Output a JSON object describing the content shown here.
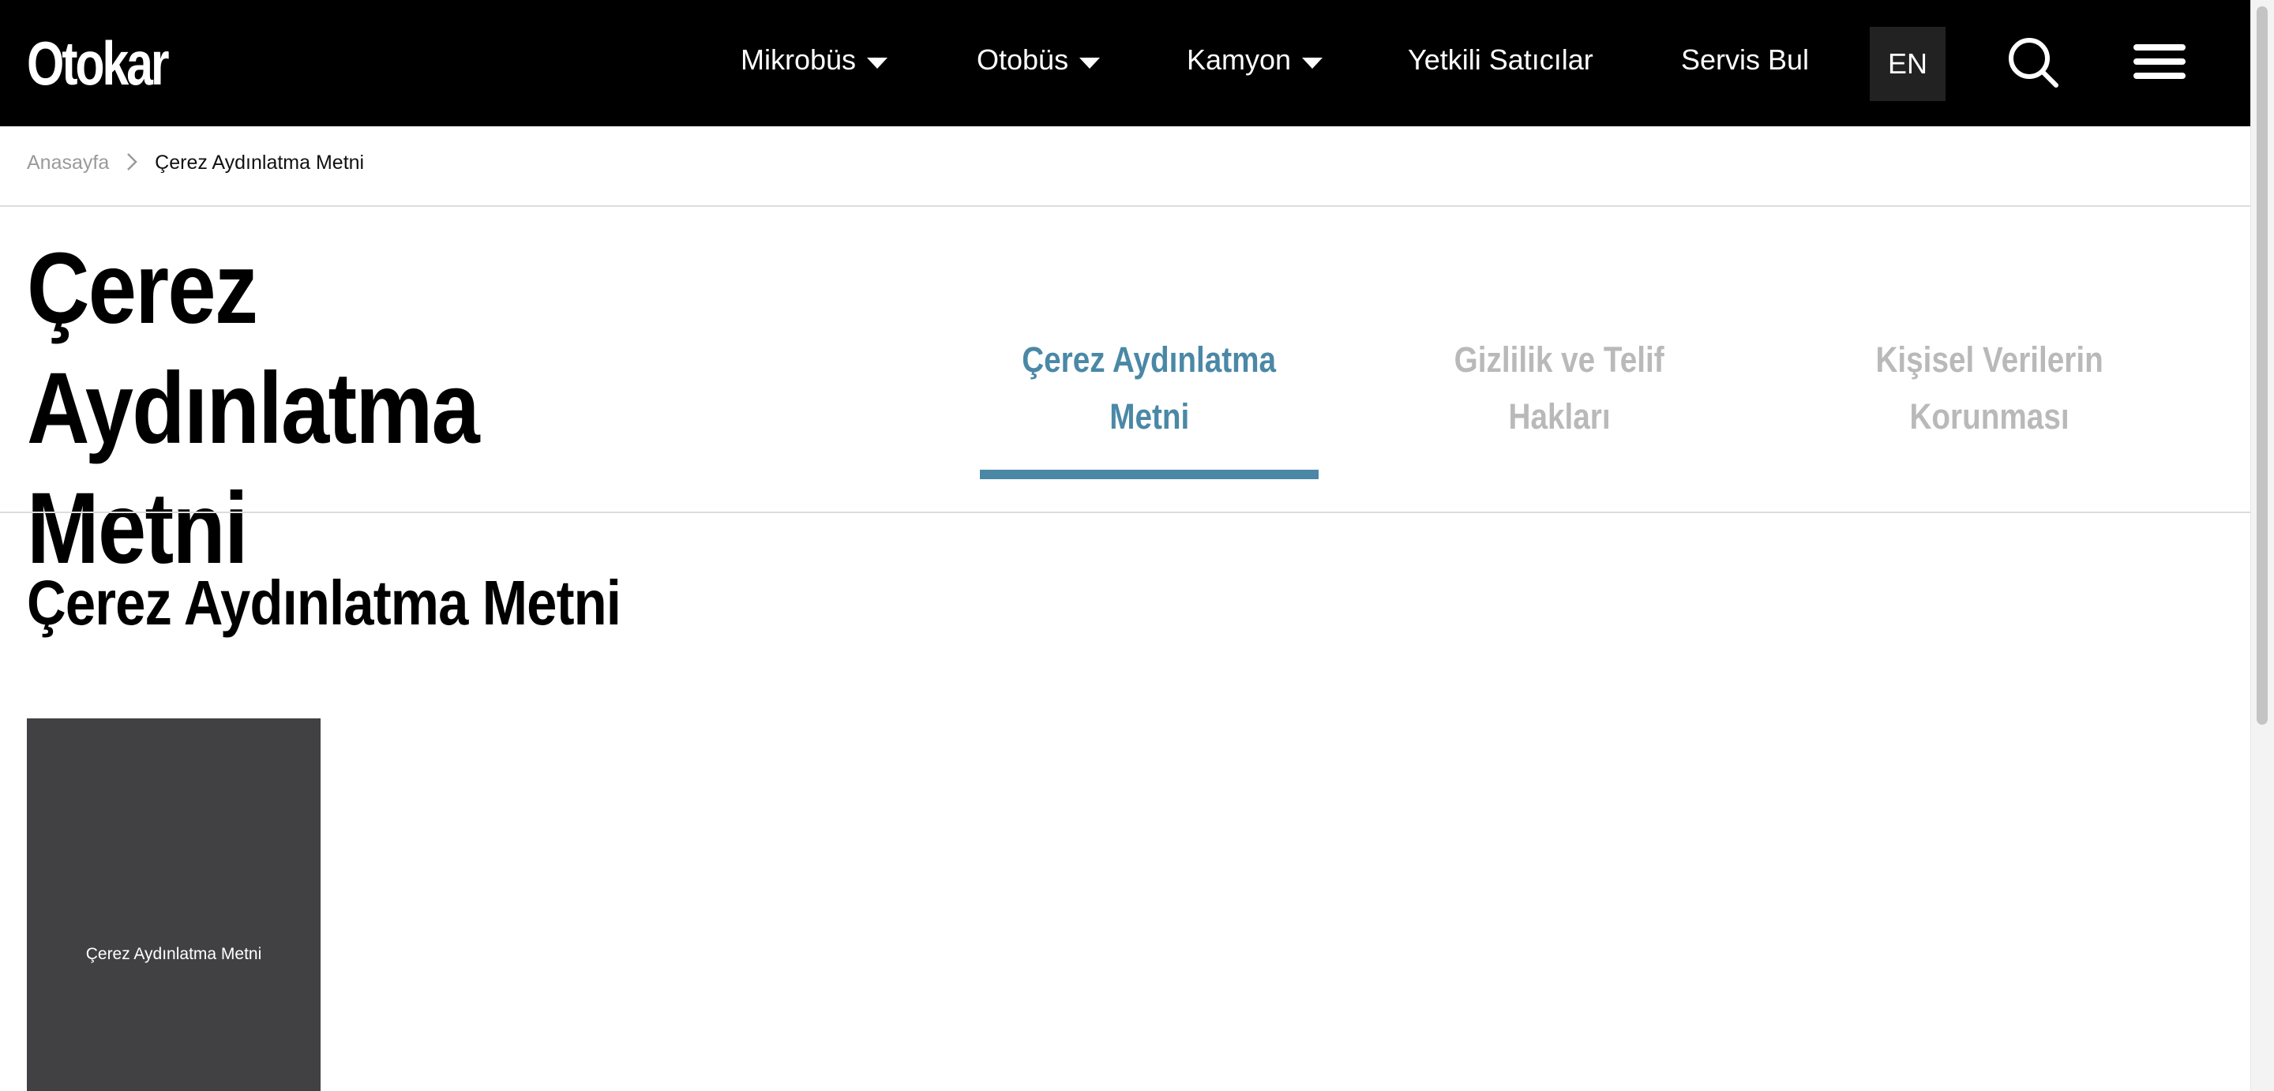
{
  "header": {
    "logo_text": "Otokar",
    "nav": [
      {
        "label": "Mikrobüs",
        "has_dropdown": true
      },
      {
        "label": "Otobüs",
        "has_dropdown": true
      },
      {
        "label": "Kamyon",
        "has_dropdown": true
      },
      {
        "label": "Yetkili Satıcılar",
        "has_dropdown": false
      },
      {
        "label": "Servis Bul",
        "has_dropdown": false
      }
    ],
    "lang_label": "EN",
    "search_icon": "search-icon",
    "menu_icon": "hamburger-menu-icon"
  },
  "breadcrumb": {
    "home": "Anasayfa",
    "separator_icon": "chevron-right-icon",
    "current": "Çerez Aydınlatma Metni"
  },
  "page": {
    "title_line1": "Çerez Aydınlatma",
    "title_line2": "Metni",
    "tabs": [
      {
        "line1": "Çerez Aydınlatma",
        "line2": "Metni",
        "active": true
      },
      {
        "line1": "Gizlilik ve Telif",
        "line2": "Hakları",
        "active": false
      },
      {
        "line1": "Kişisel Verilerin",
        "line2": "Korunması",
        "active": false
      }
    ],
    "section_heading": "Çerez Aydınlatma Metni",
    "document_card": {
      "label": "Çerez Aydınlatma Metni"
    }
  },
  "colors": {
    "topbar_bg": "#000000",
    "accent": "#4a88a6",
    "inactive_tab": "#b9b9b9",
    "card_bg": "#414042",
    "lang_bg": "#222222"
  }
}
